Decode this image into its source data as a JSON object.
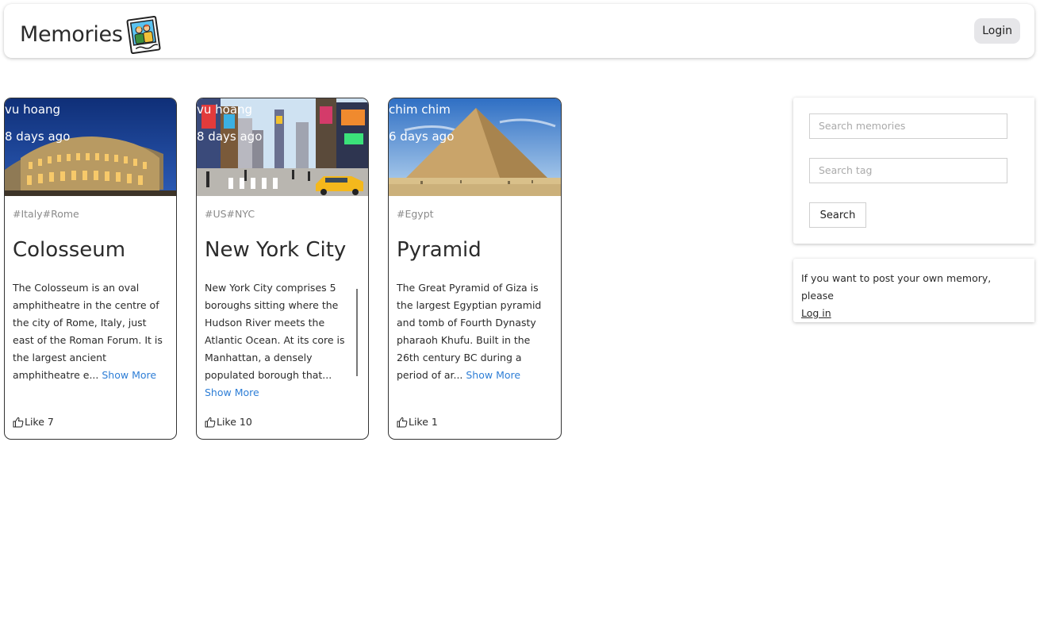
{
  "header": {
    "title": "Memories",
    "login_label": "Login"
  },
  "posts": [
    {
      "author": "vu hoang",
      "time": "8 days ago",
      "tags": "#Italy#Rome",
      "title": "Colosseum",
      "description": "The Colosseum is an oval amphitheatre in the centre of the city of Rome, Italy, just east of the Roman Forum. It is the largest ancient amphitheatre e...",
      "show_more": "Show More",
      "like_label": "Like 7"
    },
    {
      "author": "vu hoang",
      "time": "8 days ago",
      "tags": "#US#NYC",
      "title": "New York City",
      "description": "New York City comprises 5 boroughs sitting where the Hudson River meets the Atlantic Ocean. At its core is Manhattan, a densely populated borough that...",
      "show_more": "Show More",
      "like_label": "Like 10"
    },
    {
      "author": "chim chim",
      "time": "6 days ago",
      "tags": "#Egypt",
      "title": "Pyramid",
      "description": "The Great Pyramid of Giza is the largest Egyptian pyramid and tomb of Fourth Dynasty pharaoh Khufu. Built in the 26th century BC during a period of ar...",
      "show_more": "Show More",
      "like_label": "Like 1"
    }
  ],
  "search": {
    "memories_placeholder": "Search memories",
    "tag_placeholder": "Search tag",
    "button_label": "Search"
  },
  "info": {
    "text": "If you want to post your own memory, please",
    "link": "Log in"
  },
  "colors": {
    "link": "#2e7ed6",
    "muted": "#8a8a8a"
  }
}
